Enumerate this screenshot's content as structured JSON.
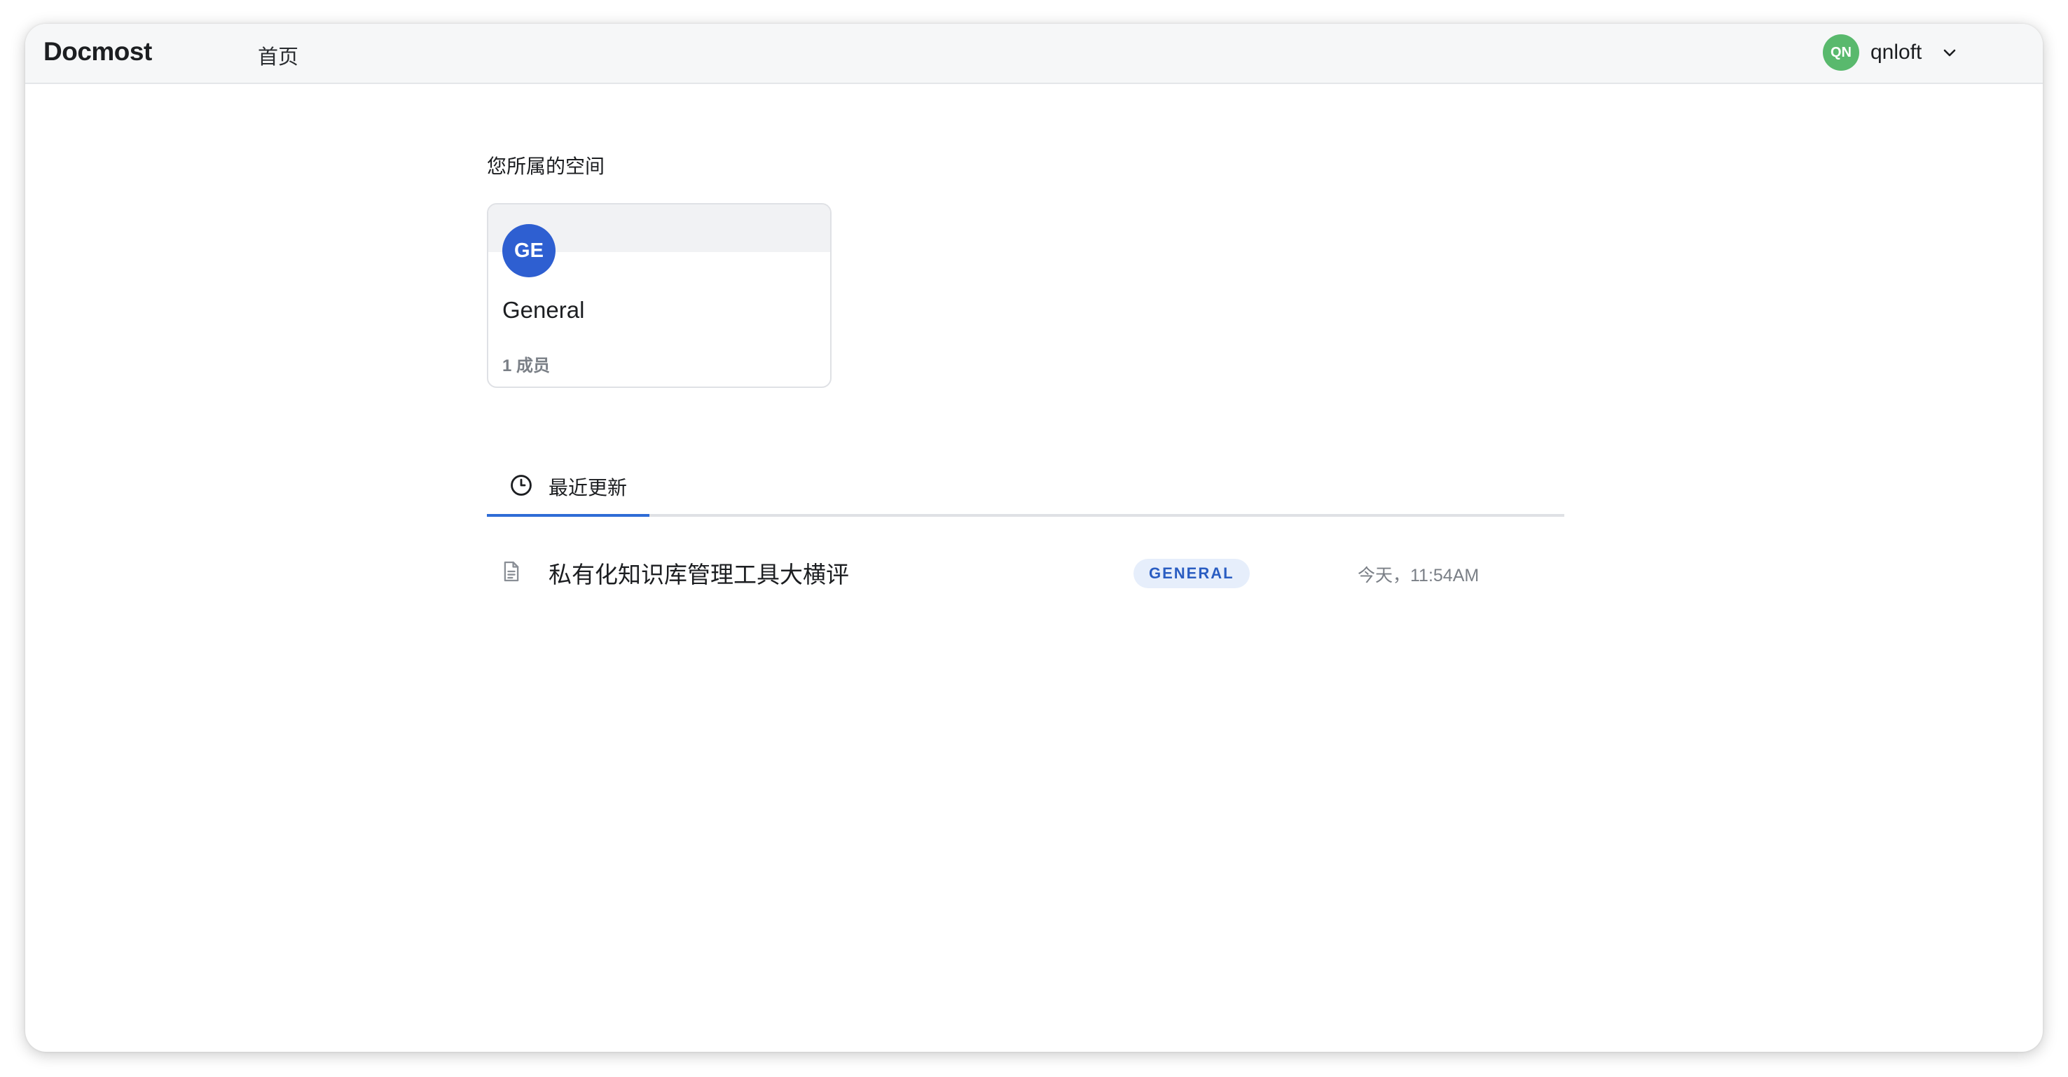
{
  "app": {
    "logo": "Docmost",
    "nav_home": "首页"
  },
  "user": {
    "initials": "QN",
    "name": "qnloft",
    "avatar_color": "#59b96d"
  },
  "spaces_section": {
    "title": "您所属的空间",
    "spaces": [
      {
        "initials": "GE",
        "name": "General",
        "members": "1 成员",
        "avatar_color": "#2e5fd1"
      }
    ]
  },
  "tabs": {
    "recent": {
      "label": "最近更新",
      "icon": "clock-icon"
    }
  },
  "recent_pages": [
    {
      "icon": "document-icon",
      "title": "私有化知识库管理工具大横评",
      "space": "GENERAL",
      "updated": "今天，11:54AM"
    }
  ],
  "colors": {
    "accent": "#2e6cd6",
    "badge_bg": "#e6eefb",
    "badge_text": "#2a5dc2"
  }
}
